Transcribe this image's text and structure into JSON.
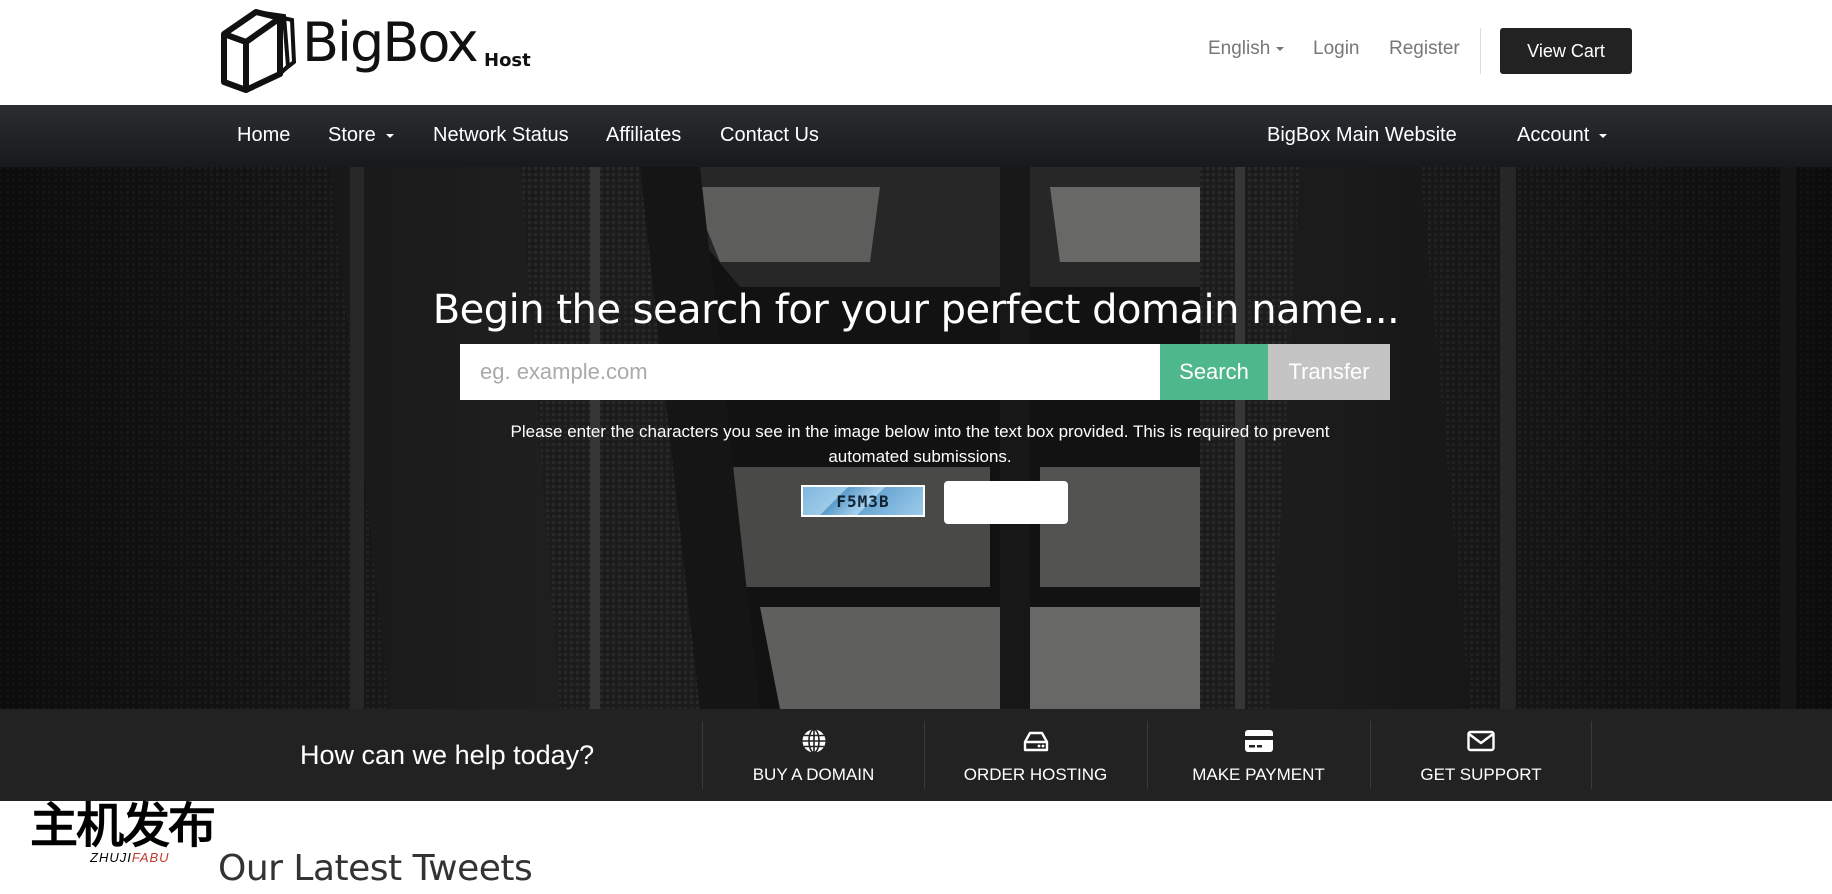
{
  "brand": {
    "name": "BigBox",
    "suffix": "Host"
  },
  "top_links": {
    "language": "English",
    "login": "Login",
    "register": "Register",
    "cart": "View Cart"
  },
  "nav": {
    "home": "Home",
    "store": "Store",
    "network_status": "Network Status",
    "affiliates": "Affiliates",
    "contact": "Contact Us",
    "main_site": "BigBox Main Website",
    "account": "Account"
  },
  "hero": {
    "title": "Begin the search for your perfect domain name...",
    "search_placeholder": "eg. example.com",
    "search_button": "Search",
    "transfer_button": "Transfer",
    "captcha_instructions": "Please enter the characters you see in the image below into the text box provided. This is required to prevent automated submissions.",
    "captcha_code": "F5M3B"
  },
  "help": {
    "title": "How can we help today?",
    "items": [
      {
        "label": "BUY A DOMAIN",
        "icon": "globe-icon"
      },
      {
        "label": "ORDER HOSTING",
        "icon": "hard-drive-icon"
      },
      {
        "label": "MAKE PAYMENT",
        "icon": "credit-card-icon"
      },
      {
        "label": "GET SUPPORT",
        "icon": "envelope-icon"
      }
    ]
  },
  "tweets": {
    "title": "Our Latest Tweets"
  },
  "watermark": {
    "cn": "主机发布",
    "en_black": "ZHUJI",
    "en_red": "FABU"
  },
  "colors": {
    "accent_green": "#4eb88c",
    "transfer_gray": "#c4c4c4",
    "nav_dark": "#1f2123",
    "help_bar": "#222222"
  }
}
